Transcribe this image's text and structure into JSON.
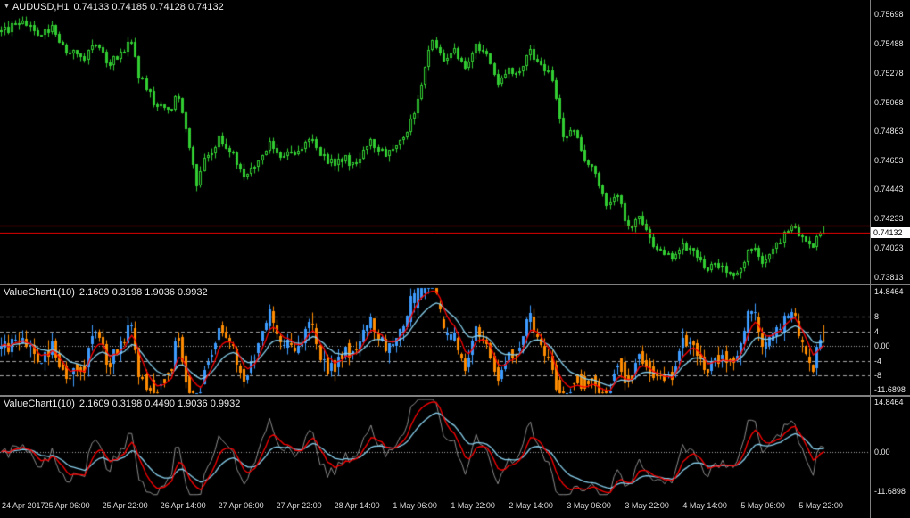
{
  "theme": {
    "background": "#000000",
    "candle_up_border": "#32CD32",
    "candle_up_fill": "#000000",
    "candle_down_border": "#32CD32",
    "candle_down_fill": "#32CD32",
    "wick": "#32CD32",
    "ask_line": "#C80000",
    "bid_line": "#FF0000",
    "vc_up": "#3E9BFF",
    "vc_down": "#FF8C00",
    "vc_fast_line": "#FF0000",
    "vc_slow_line": "#87CEEB",
    "vc_line": "#8C8C8C",
    "level_line": "#A9A9A9",
    "scale_text": "#E8E8E8",
    "divider": "#808080",
    "tag_bg": "#FFFFFF",
    "tag_fg": "#000000"
  },
  "main_chart": {
    "dropdown_icon": "▼",
    "title_symbol": "AUDUSD,H1",
    "title_ohlc": "0.74133 0.74185 0.74128 0.74132",
    "price_tag": "0.74132"
  },
  "panels": {
    "middle_title_name": "ValueChart1(10)",
    "middle_title_values": "2.1609 0.3198 1.9036 0.9932",
    "bottom_title_name": "ValueChart1(10)",
    "bottom_title_values": "2.1609 0.3198 0.4490 1.9036 0.9932"
  },
  "chart_data": {
    "type": "candlestick",
    "symbol": "AUDUSD",
    "timeframe": "H1",
    "last_ohlc": {
      "open": 0.74133,
      "high": 0.74185,
      "low": 0.74128,
      "close": 0.74132
    },
    "bid_price": 0.74132,
    "ask_price": 0.74185,
    "price_axis": {
      "top": 0.758,
      "bottom": 0.73768,
      "ticks": [
        {
          "label": "0.75698",
          "price": 0.75698
        },
        {
          "label": "0.75488",
          "price": 0.75488
        },
        {
          "label": "0.75278",
          "price": 0.75278
        },
        {
          "label": "0.75068",
          "price": 0.75068
        },
        {
          "label": "0.74863",
          "price": 0.74863
        },
        {
          "label": "0.74653",
          "price": 0.74653
        },
        {
          "label": "0.74443",
          "price": 0.74443
        },
        {
          "label": "0.74233",
          "price": 0.74233
        },
        {
          "label": "0.74023",
          "price": 0.74023
        },
        {
          "label": "0.73813",
          "price": 0.73813
        }
      ]
    },
    "candle_count": 228,
    "price_waypoints": [
      [
        0,
        0.7557
      ],
      [
        6,
        0.7564
      ],
      [
        10,
        0.7555
      ],
      [
        14,
        0.756
      ],
      [
        18,
        0.7545
      ],
      [
        22,
        0.7538
      ],
      [
        26,
        0.7547
      ],
      [
        30,
        0.7535
      ],
      [
        34,
        0.7544
      ],
      [
        36,
        0.7552
      ],
      [
        38,
        0.7525
      ],
      [
        42,
        0.7508
      ],
      [
        46,
        0.75
      ],
      [
        49,
        0.7512
      ],
      [
        52,
        0.7475
      ],
      [
        54,
        0.7448
      ],
      [
        56,
        0.7465
      ],
      [
        60,
        0.748
      ],
      [
        64,
        0.747
      ],
      [
        67,
        0.7453
      ],
      [
        70,
        0.7462
      ],
      [
        74,
        0.7478
      ],
      [
        78,
        0.7468
      ],
      [
        82,
        0.7473
      ],
      [
        86,
        0.7481
      ],
      [
        90,
        0.7462
      ],
      [
        94,
        0.7467
      ],
      [
        98,
        0.7462
      ],
      [
        102,
        0.7478
      ],
      [
        106,
        0.747
      ],
      [
        110,
        0.748
      ],
      [
        113,
        0.7492
      ],
      [
        116,
        0.752
      ],
      [
        119,
        0.7553
      ],
      [
        122,
        0.7536
      ],
      [
        125,
        0.7545
      ],
      [
        128,
        0.753
      ],
      [
        131,
        0.7548
      ],
      [
        134,
        0.7542
      ],
      [
        137,
        0.7518
      ],
      [
        140,
        0.753
      ],
      [
        143,
        0.7528
      ],
      [
        146,
        0.7543
      ],
      [
        149,
        0.7535
      ],
      [
        152,
        0.7523
      ],
      [
        155,
        0.7483
      ],
      [
        158,
        0.7488
      ],
      [
        161,
        0.7467
      ],
      [
        164,
        0.7454
      ],
      [
        167,
        0.7434
      ],
      [
        170,
        0.7442
      ],
      [
        173,
        0.7416
      ],
      [
        176,
        0.7426
      ],
      [
        179,
        0.7408
      ],
      [
        182,
        0.7402
      ],
      [
        185,
        0.7396
      ],
      [
        188,
        0.7404
      ],
      [
        191,
        0.7398
      ],
      [
        194,
        0.7388
      ],
      [
        197,
        0.7392
      ],
      [
        200,
        0.7385
      ],
      [
        203,
        0.7384
      ],
      [
        206,
        0.7398
      ],
      [
        208,
        0.7404
      ],
      [
        210,
        0.7391
      ],
      [
        213,
        0.7399
      ],
      [
        216,
        0.7412
      ],
      [
        219,
        0.7418
      ],
      [
        222,
        0.7405
      ],
      [
        224,
        0.7403
      ],
      [
        226,
        0.7415
      ],
      [
        227,
        0.74132
      ]
    ],
    "time_axis": {
      "labels": [
        "24 Apr 2017",
        "25 Apr 06:00",
        "25 Apr 22:00",
        "26 Apr 14:00",
        "27 Apr 06:00",
        "27 Apr 22:00",
        "28 Apr 14:00",
        "1 May 06:00",
        "1 May 22:00",
        "2 May 14:00",
        "3 May 06:00",
        "3 May 22:00",
        "4 May 14:00",
        "5 May 06:00",
        "5 May 22:00"
      ],
      "candle_indices": [
        2,
        18,
        34,
        50,
        66,
        82,
        98,
        114,
        130,
        146,
        162,
        178,
        194,
        210,
        226
      ]
    },
    "indicators": [
      {
        "name": "ValueChart1",
        "period": 10,
        "display": "candles",
        "current_values": [
          2.1609,
          0.3198,
          1.9036,
          0.9932
        ],
        "scale": {
          "top": 16.5,
          "bottom": -13.2,
          "ticks": [
            {
              "label": "14.8464",
              "value": 14.8464
            },
            {
              "label": "8",
              "value": 8
            },
            {
              "label": "4",
              "value": 4
            },
            {
              "label": "0.00",
              "value": 0
            },
            {
              "label": "-4",
              "value": -4
            },
            {
              "label": "-8",
              "value": -8
            },
            {
              "label": "-11.6898",
              "value": -11.6898
            }
          ]
        },
        "levels": [
          {
            "value": 8,
            "dash": true
          },
          {
            "value": 4,
            "dash": true
          },
          {
            "value": 0,
            "dash": false
          },
          {
            "value": -4,
            "dash": true
          },
          {
            "value": -8,
            "dash": true
          }
        ]
      },
      {
        "name": "ValueChart1",
        "period": 10,
        "display": "lines",
        "current_values": [
          2.1609,
          0.3198,
          0.449,
          1.9036,
          0.9932
        ],
        "scale": {
          "top": 16.5,
          "bottom": -13.2,
          "ticks": [
            {
              "label": "14.8464",
              "value": 14.8464
            },
            {
              "label": "0.00",
              "value": 0
            },
            {
              "label": "-11.6898",
              "value": -11.6898
            }
          ]
        },
        "levels": [
          {
            "value": 0,
            "dash": false
          }
        ]
      }
    ]
  }
}
